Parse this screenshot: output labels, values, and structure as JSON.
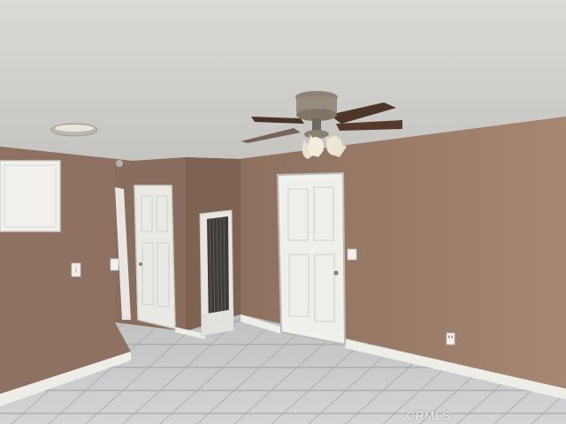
{
  "watermark": {
    "text": "CRMLS"
  },
  "palette": {
    "ceiling": "#d4d2ce",
    "wall": "#937663",
    "wall_shadow": "#7f6453",
    "trim": "#f1efea",
    "floor": "#c9cbcd",
    "grout": "#a9abad",
    "door": "#eeeeea",
    "fan_metal": "#8f8578",
    "fan_blade": "#4b3328"
  },
  "icons": [
    "ceiling-fan-icon",
    "light-fixture-icon",
    "wall-heater-icon",
    "outlet-icon",
    "light-switch-icon",
    "door-knob-icon"
  ]
}
